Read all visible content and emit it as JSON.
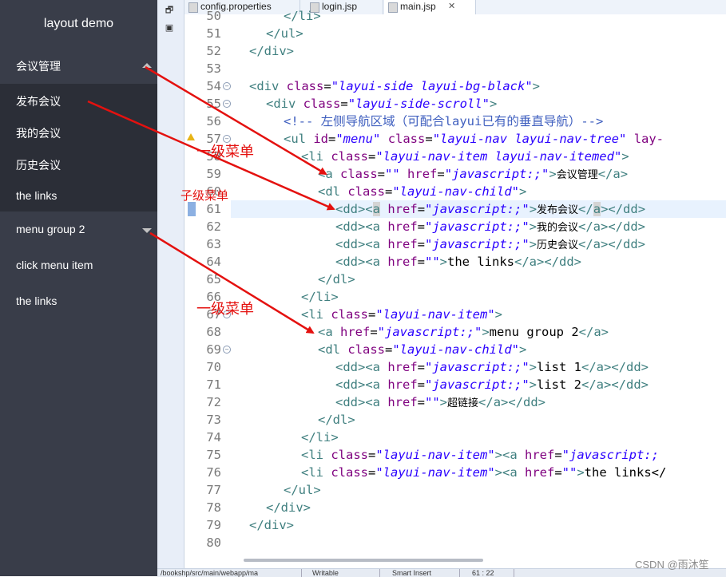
{
  "sidebar": {
    "brand": "layout demo",
    "groups": [
      {
        "label": "会议管理",
        "caret": "caret-up"
      },
      {
        "label": "menu group 2",
        "caret": "caret-down"
      }
    ],
    "children": [
      "发布会议",
      "我的会议",
      "历史会议",
      "the links"
    ],
    "items": [
      "click menu item",
      "the links"
    ]
  },
  "tabs": [
    {
      "label": "config.properties"
    },
    {
      "label": "login.jsp"
    },
    {
      "label": "main.jsp",
      "close": "✕"
    }
  ],
  "editor": {
    "line_numbers": [
      "50",
      "51",
      "52",
      "53",
      "54",
      "55",
      "56",
      "57",
      "58",
      "59",
      "60",
      "61",
      "62",
      "63",
      "64",
      "65",
      "66",
      "67",
      "68",
      "69",
      "70",
      "71",
      "72",
      "73",
      "74",
      "75",
      "76",
      "77",
      "78",
      "79",
      "80"
    ],
    "code": {
      "l51": "</ul>",
      "l52": "</div>",
      "l54_tag": "<div ",
      "l54_attr": "class",
      "l54_val": "\"layui-side layui-bg-black\"",
      "l55_tag": "<div ",
      "l55_attr": "class",
      "l55_val": "\"layui-side-scroll\"",
      "l56": "<!-- 左侧导航区域（可配合layui已有的垂直导航）-->",
      "l57_a1": "id",
      "l57_v1": "\"menu\"",
      "l57_a2": "class",
      "l57_v2": "\"layui-nav layui-nav-tree\"",
      "l57_tail": "lay-",
      "l58_val": "\"layui-nav-item layui-nav-itemed\"",
      "l59_v1": "\"\"",
      "l59_v2": "\"javascript:;\"",
      "l59_text": "会议管理",
      "l60_val": "\"layui-nav-child\"",
      "js": "\"javascript:;\"",
      "empty": "\"\"",
      "l61_text": "发布会议",
      "l62_text": "我的会议",
      "l63_text": "历史会议",
      "l64_text": "the links",
      "l67_val": "\"layui-nav-item\"",
      "l68_text": "menu group 2",
      "l70_text": "list 1",
      "l71_text": "list 2",
      "l72_text": "超链接",
      "l75_tail": "\"javascript:;",
      "l76_text": "the links</",
      "l77": "</ul>",
      "l78": "</div>",
      "l79": "</div>"
    }
  },
  "annotations": {
    "first_level_top": "一级菜单",
    "child_menu": "子级菜单",
    "first_level_bottom": "一级菜单",
    "color": "#e4110f"
  },
  "status": [
    "/bookshp/src/main/webapp/ma",
    "Writable",
    "Smart Insert",
    "61 : 22"
  ],
  "watermark": "CSDN @雨沐笙",
  "colors": {
    "sidebar_bg": "#393d49",
    "sidebar_child_bg": "#2b2e37",
    "tag": "#3f7f7f",
    "attribute": "#7f007f",
    "string": "#2a00ff",
    "comment": "#3f5fbf"
  }
}
